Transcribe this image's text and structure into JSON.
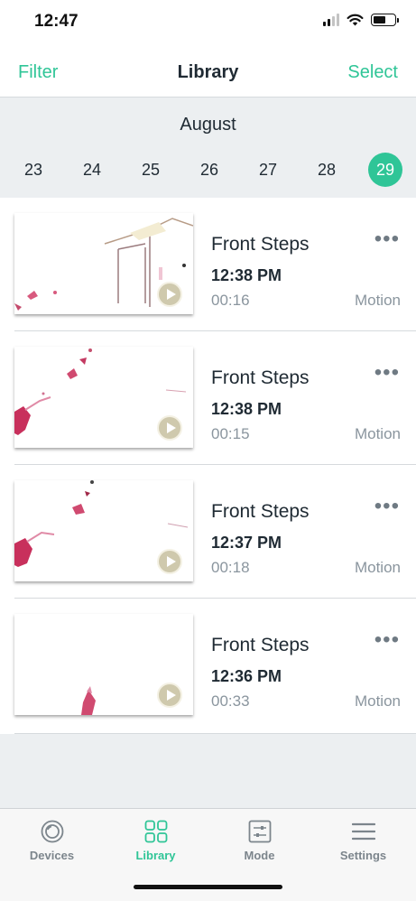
{
  "status_bar": {
    "time": "12:47",
    "signal_icon": "cellular-signal-icon",
    "wifi_icon": "wifi-icon",
    "battery_icon": "battery-icon"
  },
  "nav": {
    "left": "Filter",
    "title": "Library",
    "right": "Select"
  },
  "calendar": {
    "month": "August",
    "days": [
      "23",
      "24",
      "25",
      "26",
      "27",
      "28",
      "29"
    ],
    "selected_day": "29"
  },
  "clips": [
    {
      "camera": "Front Steps",
      "time": "12:38 PM",
      "duration": "00:16",
      "type": "Motion"
    },
    {
      "camera": "Front Steps",
      "time": "12:38 PM",
      "duration": "00:15",
      "type": "Motion"
    },
    {
      "camera": "Front Steps",
      "time": "12:37 PM",
      "duration": "00:18",
      "type": "Motion"
    },
    {
      "camera": "Front Steps",
      "time": "12:36 PM",
      "duration": "00:33",
      "type": "Motion"
    }
  ],
  "tab_bar": {
    "tabs": [
      {
        "label": "Devices",
        "icon": "devices-icon",
        "active": false
      },
      {
        "label": "Library",
        "icon": "library-grid-icon",
        "active": true
      },
      {
        "label": "Mode",
        "icon": "mode-sliders-icon",
        "active": false
      },
      {
        "label": "Settings",
        "icon": "settings-menu-icon",
        "active": false
      }
    ]
  },
  "colors": {
    "accent": "#2fc597",
    "text": "#1f2a33",
    "muted": "#8a959e",
    "background": "#eceff1"
  }
}
